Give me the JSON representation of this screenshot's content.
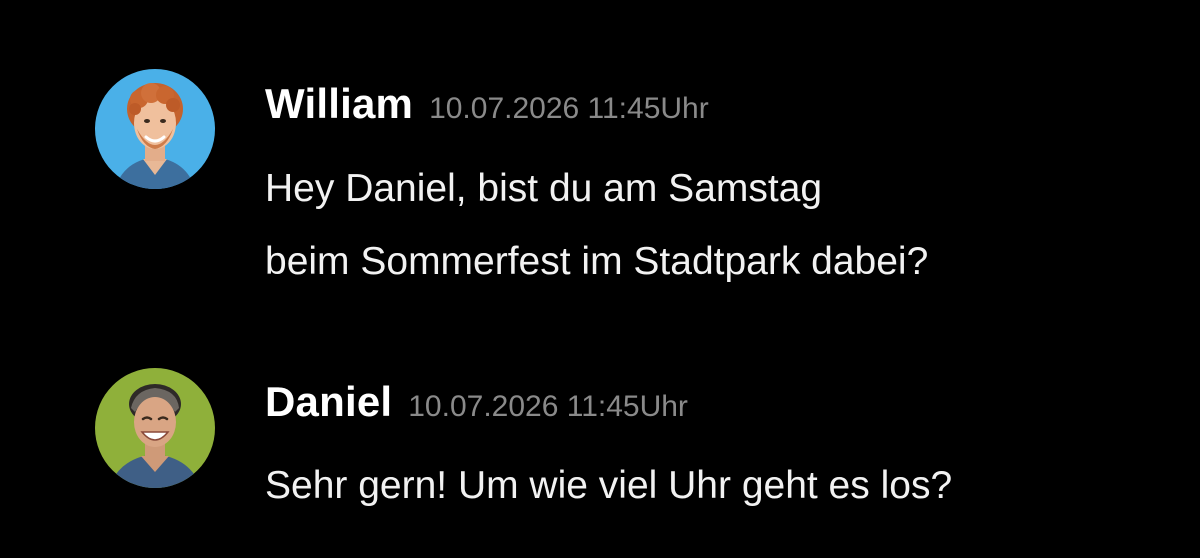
{
  "messages": [
    {
      "author": "William",
      "timestamp": "10.07.2026 11:45Uhr",
      "avatar": {
        "icon": "avatar-william-icon",
        "background": "#4ab0e8"
      },
      "lines": [
        "Hey Daniel, bist du am Samstag",
        "beim Sommerfest im Stadtpark dabei?"
      ]
    },
    {
      "author": "Daniel",
      "timestamp": "10.07.2026 11:45Uhr",
      "avatar": {
        "icon": "avatar-daniel-icon",
        "background": "#8fb03a"
      },
      "lines": [
        "Sehr gern! Um wie viel Uhr geht es los?"
      ]
    }
  ],
  "colors": {
    "background": "#000000",
    "name": "#ffffff",
    "timestamp": "#8a8a8a",
    "text": "#f2f2f2"
  }
}
